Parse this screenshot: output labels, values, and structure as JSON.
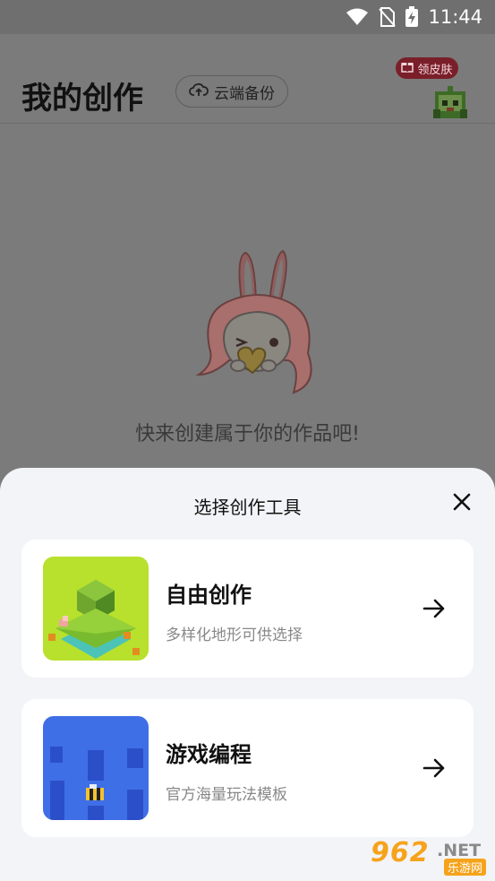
{
  "status_bar": {
    "time": "11:44"
  },
  "header": {
    "title": "我的创作",
    "backup_label": "云端备份",
    "skin_badge": "领皮肤"
  },
  "empty_state": {
    "text": "快来创建属于你的作品吧!"
  },
  "sheet": {
    "title": "选择创作工具",
    "options": [
      {
        "name": "自由创作",
        "desc": "多样化地形可供选择"
      },
      {
        "name": "游戏编程",
        "desc": "官方海量玩法模板"
      }
    ]
  },
  "watermark": {
    "number": "962",
    "suffix": ".NET",
    "sub": "乐游网"
  },
  "colors": {
    "overlay": "#7b7b7b",
    "sheet_bg": "#f3f4f7",
    "card_bg": "#ffffff",
    "badge": "#7a1f2a",
    "thumb_green": "#b7e12c",
    "thumb_blue": "#3f6fe6"
  }
}
